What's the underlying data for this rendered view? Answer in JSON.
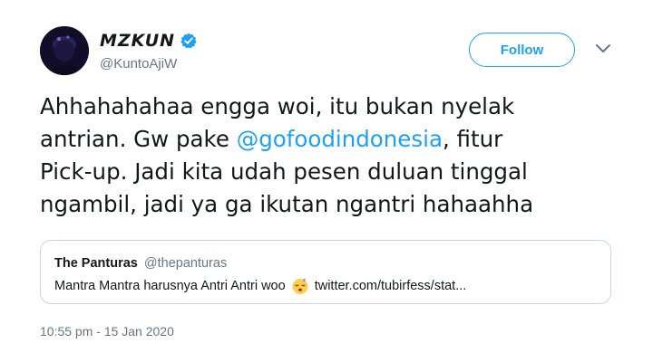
{
  "author": {
    "display_name": "MZKUN",
    "handle": "@KuntoAjiW",
    "verified": true,
    "avatar_icon": "profile-photo"
  },
  "actions": {
    "follow_label": "Follow",
    "more_icon": "chevron-down-icon"
  },
  "tweet": {
    "text_parts": {
      "line1": "Ahhahahahaa engga woi, itu bukan nyelak",
      "line2_before": "antrian. Gw pake ",
      "mention": "@gofoodindonesia",
      "line2_after": ", fitur",
      "line3": "Pick-up. Jadi kita udah pesen duluan tinggal",
      "line4": "ngambil, jadi ya ga ikutan ngantri hahaahha"
    }
  },
  "quoted_tweet": {
    "name": "The Panturas",
    "handle": "@thepanturas",
    "text_before": "Mantra Mantra harusnya Antri Antri woo",
    "emoji": "sleeping-face-emoji",
    "text_after": "twitter.com/tubirfess/stat..."
  },
  "timestamp": "10:55 pm - 15 Jan 2020",
  "colors": {
    "accent": "#1da1f2",
    "secondary_text": "#657786",
    "border": "#ccd6dd"
  }
}
